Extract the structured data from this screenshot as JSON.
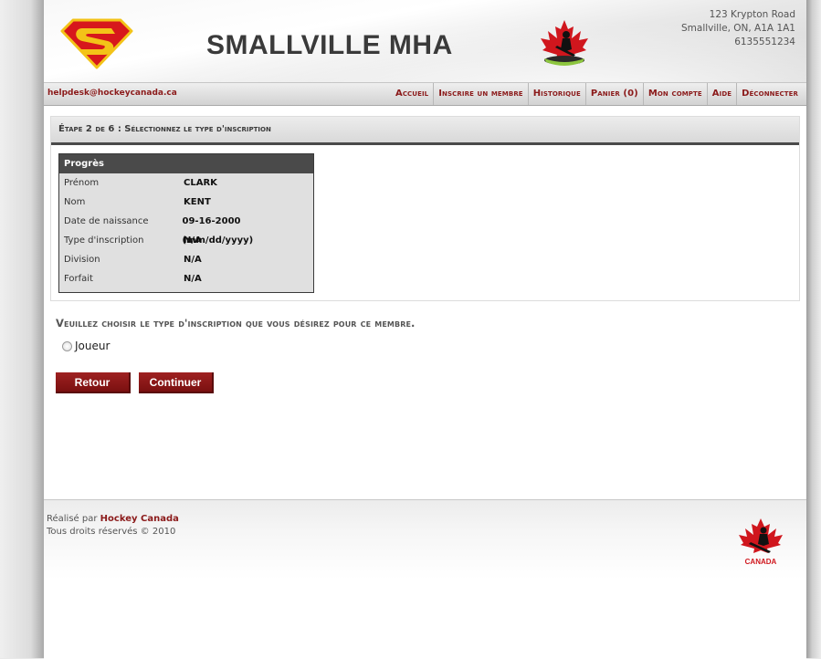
{
  "header": {
    "title": "SMALLVILLE MHA",
    "address": [
      "123 Krypton Road",
      "Smallville, ON, A1A 1A1",
      "6135551234"
    ]
  },
  "nav": {
    "helpdesk": "helpdesk@hockeycanada.ca",
    "items": [
      "Accueil",
      "Inscrire un membre",
      "Historique",
      "Panier (0)",
      "Mon compte",
      "Aide",
      "Déconnecter"
    ]
  },
  "step": {
    "heading": "Étape 2 de 6 : Sélectionnez le type d'inscription"
  },
  "progress": {
    "title": "Progrès",
    "rows": [
      {
        "label": "Prénom",
        "value": "CLARK"
      },
      {
        "label": "Nom",
        "value": "KENT"
      },
      {
        "label": "Date de naissance",
        "value": "09-16-2000 (mm/dd/yyyy)"
      },
      {
        "label": "Type d'inscription",
        "value": "N/A"
      },
      {
        "label": "Division",
        "value": "N/A"
      },
      {
        "label": "Forfait",
        "value": "N/A"
      }
    ]
  },
  "choice": {
    "heading": "Veuillez choisir le type d'inscription que vous désirez pour ce membre.",
    "options": [
      "Joueur"
    ]
  },
  "buttons": {
    "back": "Retour",
    "continue": "Continuer"
  },
  "footer": {
    "made_by_prefix": "Réalisé par",
    "made_by_name": "Hockey Canada",
    "copyright": "Tous droits réservés © 2010",
    "logo_text": "CANADA"
  },
  "colors": {
    "accent": "#8b1a1a",
    "button": "#8e1717",
    "step_bar": "#4a4a4a"
  },
  "icons": [
    "superman-logo",
    "ohf-logo",
    "hockey-canada-logo"
  ]
}
